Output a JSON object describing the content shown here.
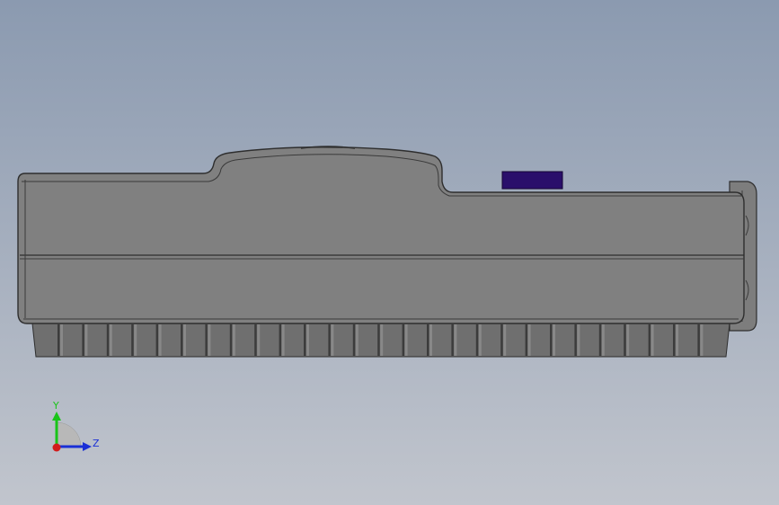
{
  "viewport": {
    "background_top": "#8b9ab0",
    "background_bottom": "#c1c5cd"
  },
  "model": {
    "body_color": "#808080",
    "edge_color": "#2e2e2e",
    "highlight_color": "#9a9a9a",
    "button_color": "#2a0f6b",
    "foot_color": "#6f6f6f"
  },
  "triad": {
    "y_label": "Y",
    "z_label": "Z",
    "y_color": "#19c419",
    "z_color": "#1a2fd6",
    "x_color": "#d21c1c"
  }
}
